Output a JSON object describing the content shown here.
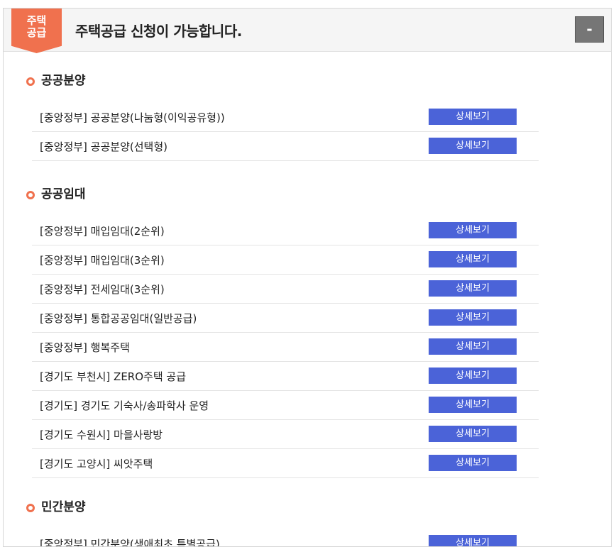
{
  "header": {
    "badge_line1": "주택",
    "badge_line2": "공급",
    "title": "주택공급 신청이 가능합니다.",
    "collapse_label": "-"
  },
  "detail_label": "상세보기",
  "sections": [
    {
      "title": "공공분양",
      "items": [
        "[중앙정부] 공공분양(나눔형(이익공유형))",
        "[중앙정부] 공공분양(선택형)"
      ]
    },
    {
      "title": "공공임대",
      "items": [
        "[중앙정부] 매입임대(2순위)",
        "[중앙정부] 매입임대(3순위)",
        "[중앙정부] 전세임대(3순위)",
        "[중앙정부] 통합공공임대(일반공급)",
        "[중앙정부] 행복주택",
        "[경기도 부천시] ZERO주택 공급",
        "[경기도] 경기도 기숙사/송파학사 운영",
        "[경기도 수원시] 마을사랑방",
        "[경기도 고양시] 씨앗주택"
      ]
    },
    {
      "title": "민간분양",
      "items": [
        "[중앙정부] 민간분양(생애최초 특별공급)"
      ]
    }
  ],
  "colors": {
    "accent": "#f0714e",
    "button": "#4b63d8"
  }
}
